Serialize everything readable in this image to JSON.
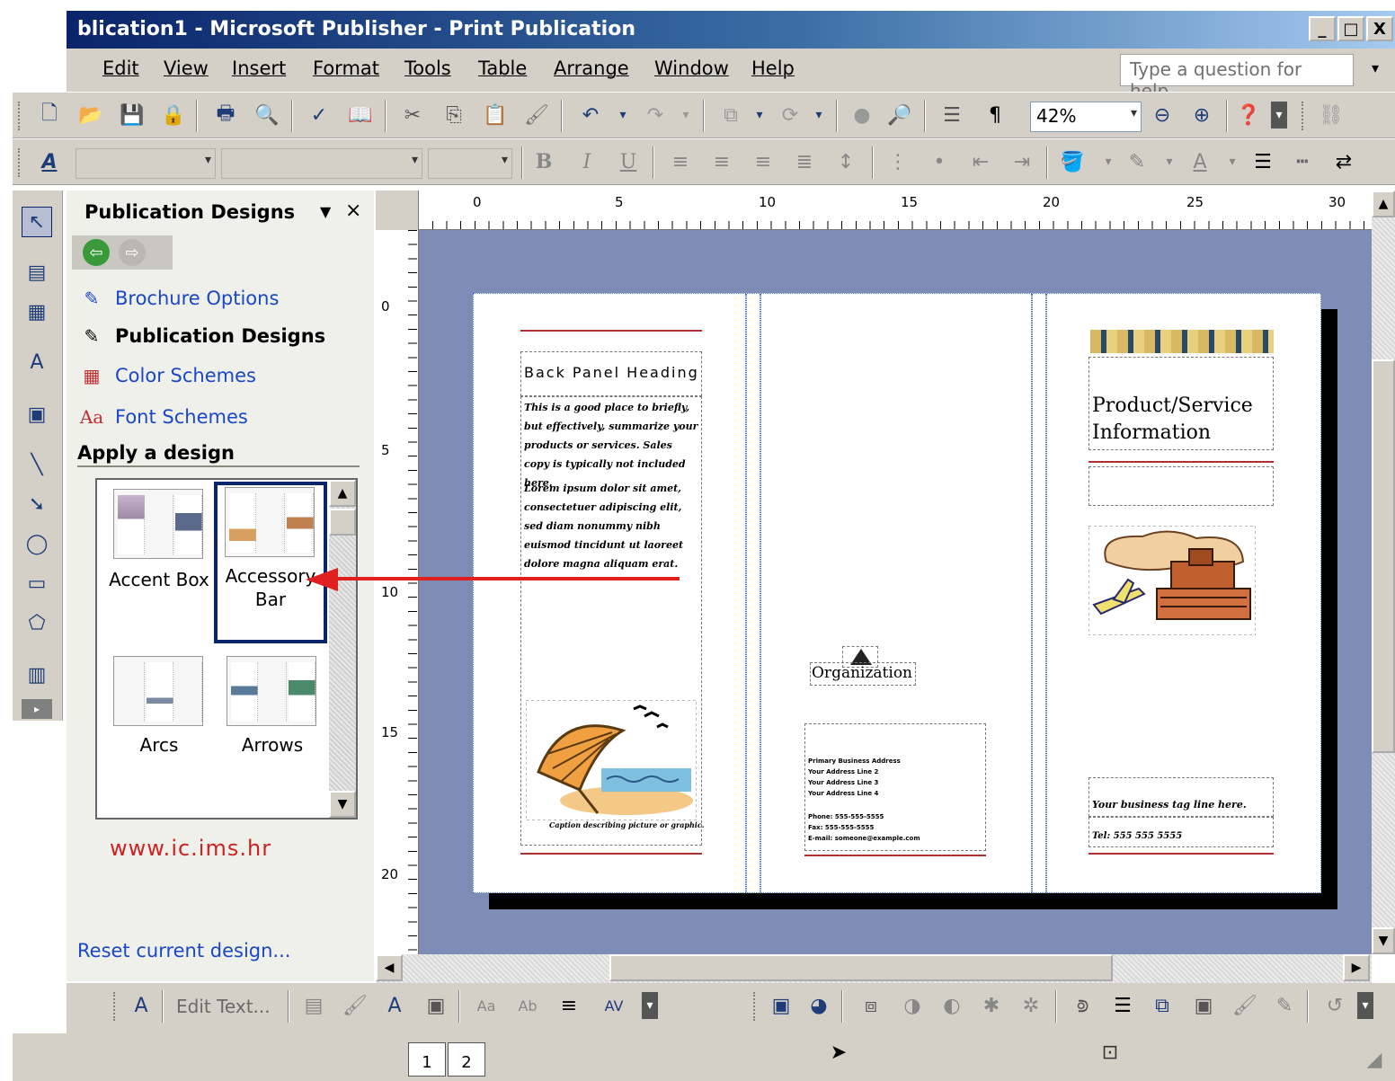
{
  "window": {
    "title": "blication1 - Microsoft Publisher - Print Publication",
    "minimize": "_",
    "maximize": "□",
    "close": "X"
  },
  "menu": {
    "items": [
      "Edit",
      "View",
      "Insert",
      "Format",
      "Tools",
      "Table",
      "Arrange",
      "Window",
      "Help"
    ],
    "help_placeholder": "Type a question for help"
  },
  "standard_toolbar": {
    "zoom": "42%"
  },
  "formatting_toolbar": {
    "bold": "B",
    "italic": "I",
    "underline": "U",
    "font_color": "A"
  },
  "task_pane": {
    "title": "Publication Designs",
    "links": [
      {
        "label": "Brochure Options",
        "current": false
      },
      {
        "label": "Publication Designs",
        "current": true
      },
      {
        "label": "Color Schemes",
        "current": false
      },
      {
        "label": "Font Schemes",
        "current": false
      }
    ],
    "section_title": "Apply a design",
    "designs": [
      {
        "label_line1": "Accent Box",
        "label_line2": "",
        "selected": false
      },
      {
        "label_line1": "Accessory",
        "label_line2": "Bar",
        "selected": true
      },
      {
        "label_line1": "Arcs",
        "label_line2": "",
        "selected": false
      },
      {
        "label_line1": "Arrows",
        "label_line2": "",
        "selected": false
      }
    ],
    "watermark": "www.ic.ims.hr",
    "reset_link": "Reset current design..."
  },
  "rulers": {
    "horizontal": [
      "0",
      "5",
      "10",
      "15",
      "20",
      "25",
      "30"
    ],
    "vertical": [
      "0",
      "5",
      "10",
      "15",
      "20"
    ]
  },
  "page": {
    "back_panel_heading": "Back Panel Heading",
    "back_panel_body_1": "This is a good place to briefly, but effectively, summarize your products or services. Sales copy is typically not included here.",
    "back_panel_body_2": "Lorem ipsum dolor sit amet, consectetuer adipiscing elit, sed diam nonummy nibh euismod tincidunt ut laoreet dolore magna aliquam erat.",
    "caption": "Caption describing picture or graphic.",
    "organization": "Organization",
    "address_lines": [
      "Primary Business Address",
      "Your Address Line 2",
      "Your Address Line 3",
      "Your Address Line 4"
    ],
    "contact_lines": [
      "Phone: 555-555-5555",
      "Fax: 555-555-5555",
      "E-mail: someone@example.com"
    ],
    "title": "Product/Service Information",
    "tagline": "Your business tag line here.",
    "tel": "Tel: 555 555 5555"
  },
  "bottom_toolbar": {
    "edit_text": "Edit Text..."
  },
  "status": {
    "pages": [
      "1",
      "2"
    ]
  }
}
